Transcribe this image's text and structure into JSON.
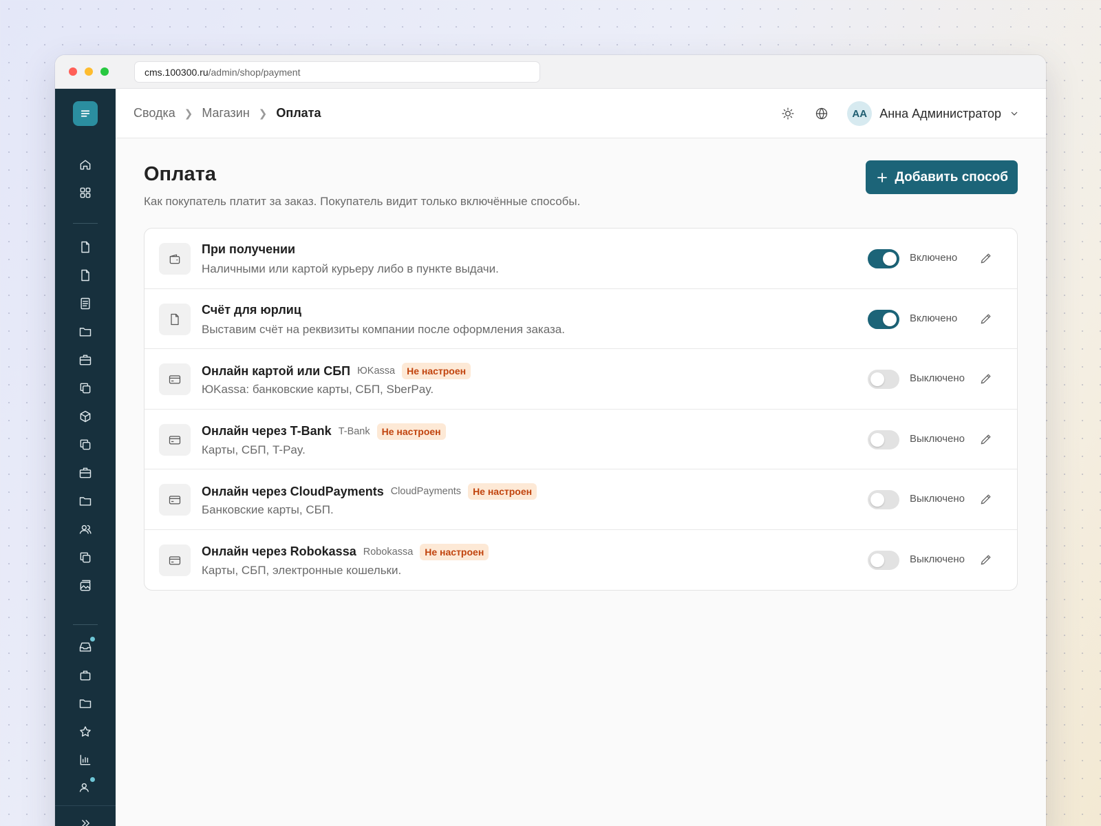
{
  "browser": {
    "url_host": "cms.100300.ru",
    "url_path": "/admin/shop/payment"
  },
  "sidebar": {
    "items": [
      "home-icon",
      "grid-icon",
      "file-icon",
      "file-icon",
      "document-icon",
      "folder-icon",
      "briefcase-icon",
      "copy-icon",
      "box-icon",
      "copy-icon",
      "briefcase-icon",
      "folder-icon",
      "users-icon",
      "copy-icon",
      "image-icon",
      "inbox-icon",
      "bag-icon",
      "folder-icon",
      "star-icon",
      "chart-icon",
      "users-icon"
    ]
  },
  "breadcrumb": [
    "Сводка",
    "Магазин",
    "Оплата"
  ],
  "user": {
    "initials": "АА",
    "name": "Анна Администратор"
  },
  "page": {
    "title": "Оплата",
    "subtitle": "Как покупатель платит за заказ. Покупатель видит только включённые способы.",
    "add_button": "Добавить способ"
  },
  "methods": [
    {
      "name": "При получении",
      "provider": "",
      "badge": "",
      "description": "Наличными или картой курьеру либо в пункте выдачи.",
      "enabled": true,
      "status": "Включено",
      "icon": "wallet-icon"
    },
    {
      "name": "Счёт для юрлиц",
      "provider": "",
      "badge": "",
      "description": "Выставим счёт на реквизиты компании после оформления заказа.",
      "enabled": true,
      "status": "Включено",
      "icon": "file-icon"
    },
    {
      "name": "Онлайн картой или СБП",
      "provider": "ЮKassa",
      "badge": "Не настроен",
      "description": "ЮKassa: банковские карты, СБП, SberPay.",
      "enabled": false,
      "status": "Выключено",
      "icon": "card-icon"
    },
    {
      "name": "Онлайн через T-Bank",
      "provider": "T-Bank",
      "badge": "Не настроен",
      "description": "Карты, СБП, T-Pay.",
      "enabled": false,
      "status": "Выключено",
      "icon": "card-icon"
    },
    {
      "name": "Онлайн через CloudPayments",
      "provider": "CloudPayments",
      "badge": "Не настроен",
      "description": "Банковские карты, СБП.",
      "enabled": false,
      "status": "Выключено",
      "icon": "card-icon"
    },
    {
      "name": "Онлайн через Robokassa",
      "provider": "Robokassa",
      "badge": "Не настроен",
      "description": "Карты, СБП, электронные кошельки.",
      "enabled": false,
      "status": "Выключено",
      "icon": "card-icon"
    }
  ],
  "colors": {
    "accent": "#1c6478",
    "sidebar": "#17303d",
    "badge_bg": "#fde9d6",
    "badge_text": "#c1440e"
  }
}
